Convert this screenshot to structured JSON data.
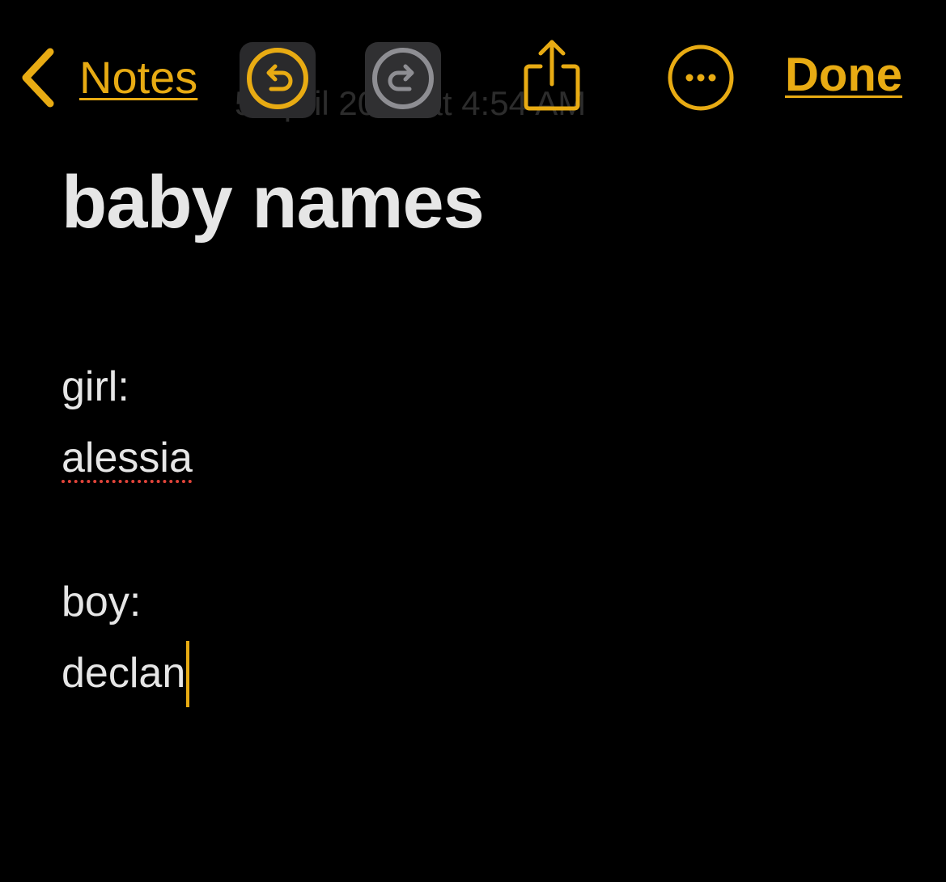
{
  "toolbar": {
    "back_label": "Notes",
    "done_label": "Done",
    "hidden_date": "5 April 2025 at 4:54 AM"
  },
  "note": {
    "title": "baby names",
    "lines": {
      "girl_header": "girl:",
      "girl_name": "alessia",
      "boy_header": "boy:",
      "boy_name": "declan"
    }
  },
  "icons": {
    "back": "chevron-left-icon",
    "undo": "undo-icon",
    "redo": "redo-icon",
    "share": "share-icon",
    "more": "more-icon"
  },
  "colors": {
    "accent": "#e8ab13",
    "background": "#000000",
    "text": "#e6e6e6",
    "spellcheck": "#e0443a",
    "disabled": "#8e8e93"
  }
}
